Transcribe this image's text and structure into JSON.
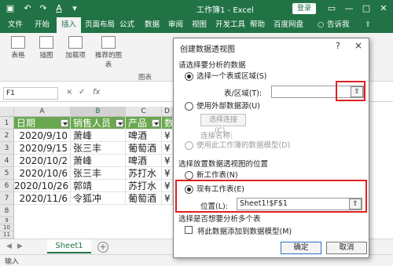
{
  "titlebar": {
    "title": "工作簿1 - Excel",
    "login": "登录",
    "quick_icons": [
      "save-icon",
      "undo-icon",
      "redo-icon",
      "font-color-icon",
      "customize-icon"
    ]
  },
  "ribbon": {
    "tabs": [
      "文件",
      "开始",
      "插入",
      "页面布局",
      "公式",
      "数据",
      "审阅",
      "视图",
      "开发工具",
      "帮助",
      "百度网盘",
      "告诉我"
    ],
    "active_tab": "插入",
    "groups": [
      "表格",
      "插图",
      "加载项",
      "推荐的图表"
    ],
    "group_label": "图表"
  },
  "formula_bar": {
    "name_box": "F1",
    "cancel_sym": "×",
    "enter_sym": "✓",
    "fx_sym": "fx"
  },
  "grid": {
    "columns": [
      "A",
      "B",
      "C",
      "D"
    ],
    "rows": [
      "1",
      "2",
      "3",
      "4",
      "5",
      "6",
      "7",
      "8",
      "9",
      "10",
      "11"
    ],
    "headers": [
      "日期",
      "销售人员",
      "产品",
      "数"
    ],
    "data": [
      [
        "2020/9/10",
        "萧峰",
        "啤酒",
        "¥"
      ],
      [
        "2020/9/15",
        "张三丰",
        "葡萄酒",
        "¥"
      ],
      [
        "2020/10/2",
        "萧峰",
        "啤酒",
        "¥"
      ],
      [
        "2020/10/6",
        "张三丰",
        "苏打水",
        "¥"
      ],
      [
        "2020/10/26",
        "郭靖",
        "苏打水",
        "¥"
      ],
      [
        "2020/11/6",
        "令狐冲",
        "葡萄酒",
        "¥"
      ]
    ]
  },
  "sheet_tabs": {
    "active": "Sheet1",
    "add_label": "+"
  },
  "status": {
    "mode": "输入"
  },
  "dialog": {
    "title": "创建数据透视图",
    "help": "?",
    "close": "×",
    "section_source": "请选择要分析的数据",
    "opt_select_table": "选择一个表或区域(S)",
    "table_range_label": "表/区域(T):",
    "table_range_value": "",
    "opt_external": "使用外部数据源(U)",
    "choose_connection": "选择连接(C)...",
    "connection_name_label": "连接名称:",
    "opt_data_model": "使用此工作簿的数据模型(D)",
    "section_location": "选择放置数据透视图的位置",
    "opt_new_sheet": "新工作表(N)",
    "opt_existing_sheet": "现有工作表(E)",
    "location_label": "位置(L):",
    "location_value": "Sheet1!$F$1",
    "section_multi": "选择是否想要分析多个表",
    "add_to_model": "将此数据添加到数据模型(M)",
    "ok": "确定",
    "cancel": "取消",
    "collapse_btn": "⇧"
  }
}
